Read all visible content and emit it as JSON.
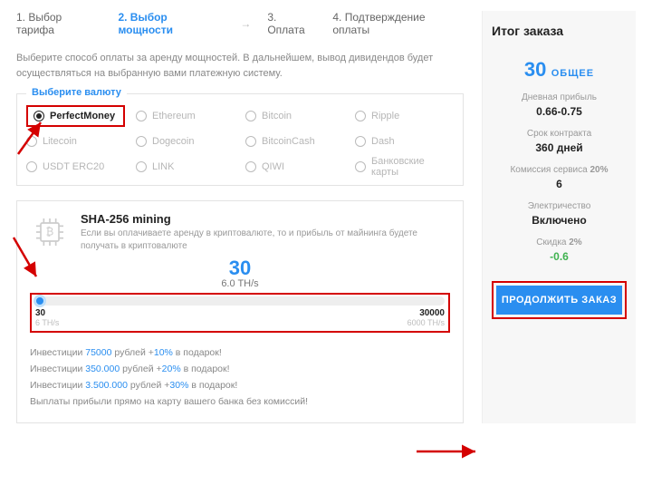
{
  "steps": {
    "s1": "1. Выбор тарифа",
    "s2": "2. Выбор мощности",
    "s3": "3. Оплата",
    "s4": "4. Подтверждение оплаты"
  },
  "description": "Выберите способ оплаты за аренду мощностей. В дальнейшем, вывод дивидендов будет осуществляться на выбранную вами платежную систему.",
  "currency": {
    "legend": "Выберите валюту",
    "options": [
      "PerfectMoney",
      "Ethereum",
      "Bitcoin",
      "Ripple",
      "Litecoin",
      "Dogecoin",
      "BitcoinCash",
      "Dash",
      "USDT ERC20",
      "LINK",
      "QIWI",
      "Банковские карты"
    ]
  },
  "mining": {
    "title": "SHA-256 mining",
    "sub": "Если вы оплачиваете аренду в криптовалюте, то и прибыль от майнинга будете получать в криптовалюте",
    "value": "30",
    "unit": "6.0 TH/s",
    "min": "30",
    "min_unit": "6 TH/s",
    "max": "30000",
    "max_unit": "6000 TH/s"
  },
  "bonuses": {
    "l1a": "Инвестиции ",
    "l1b": "75000",
    "l1c": " рублей +",
    "l1d": "10%",
    "l1e": " в подарок!",
    "l2a": "Инвестиции ",
    "l2b": "350.000",
    "l2c": " рублей +",
    "l2d": "20%",
    "l2e": " в подарок!",
    "l3a": "Инвестиции ",
    "l3b": "3.500.000",
    "l3c": " рублей +",
    "l3d": "30%",
    "l3e": " в подарок!",
    "l4": "Выплаты прибыли прямо на карту вашего банка без комиссий!"
  },
  "summary": {
    "title": "Итог заказа",
    "total_val": "30",
    "total_label": "ОБЩЕЕ",
    "daily_label": "Дневная прибыль",
    "daily_val": "0.66-0.75",
    "term_label": "Срок контракта",
    "term_val": "360 дней",
    "fee_label_a": "Комиссия сервиса ",
    "fee_label_b": "20%",
    "fee_val": "6",
    "elec_label": "Электричество",
    "elec_val": "Включено",
    "disc_label_a": "Скидка ",
    "disc_label_b": "2%",
    "disc_val": "-0.6",
    "continue": "ПРОДОЛЖИТЬ ЗАКАЗ"
  }
}
